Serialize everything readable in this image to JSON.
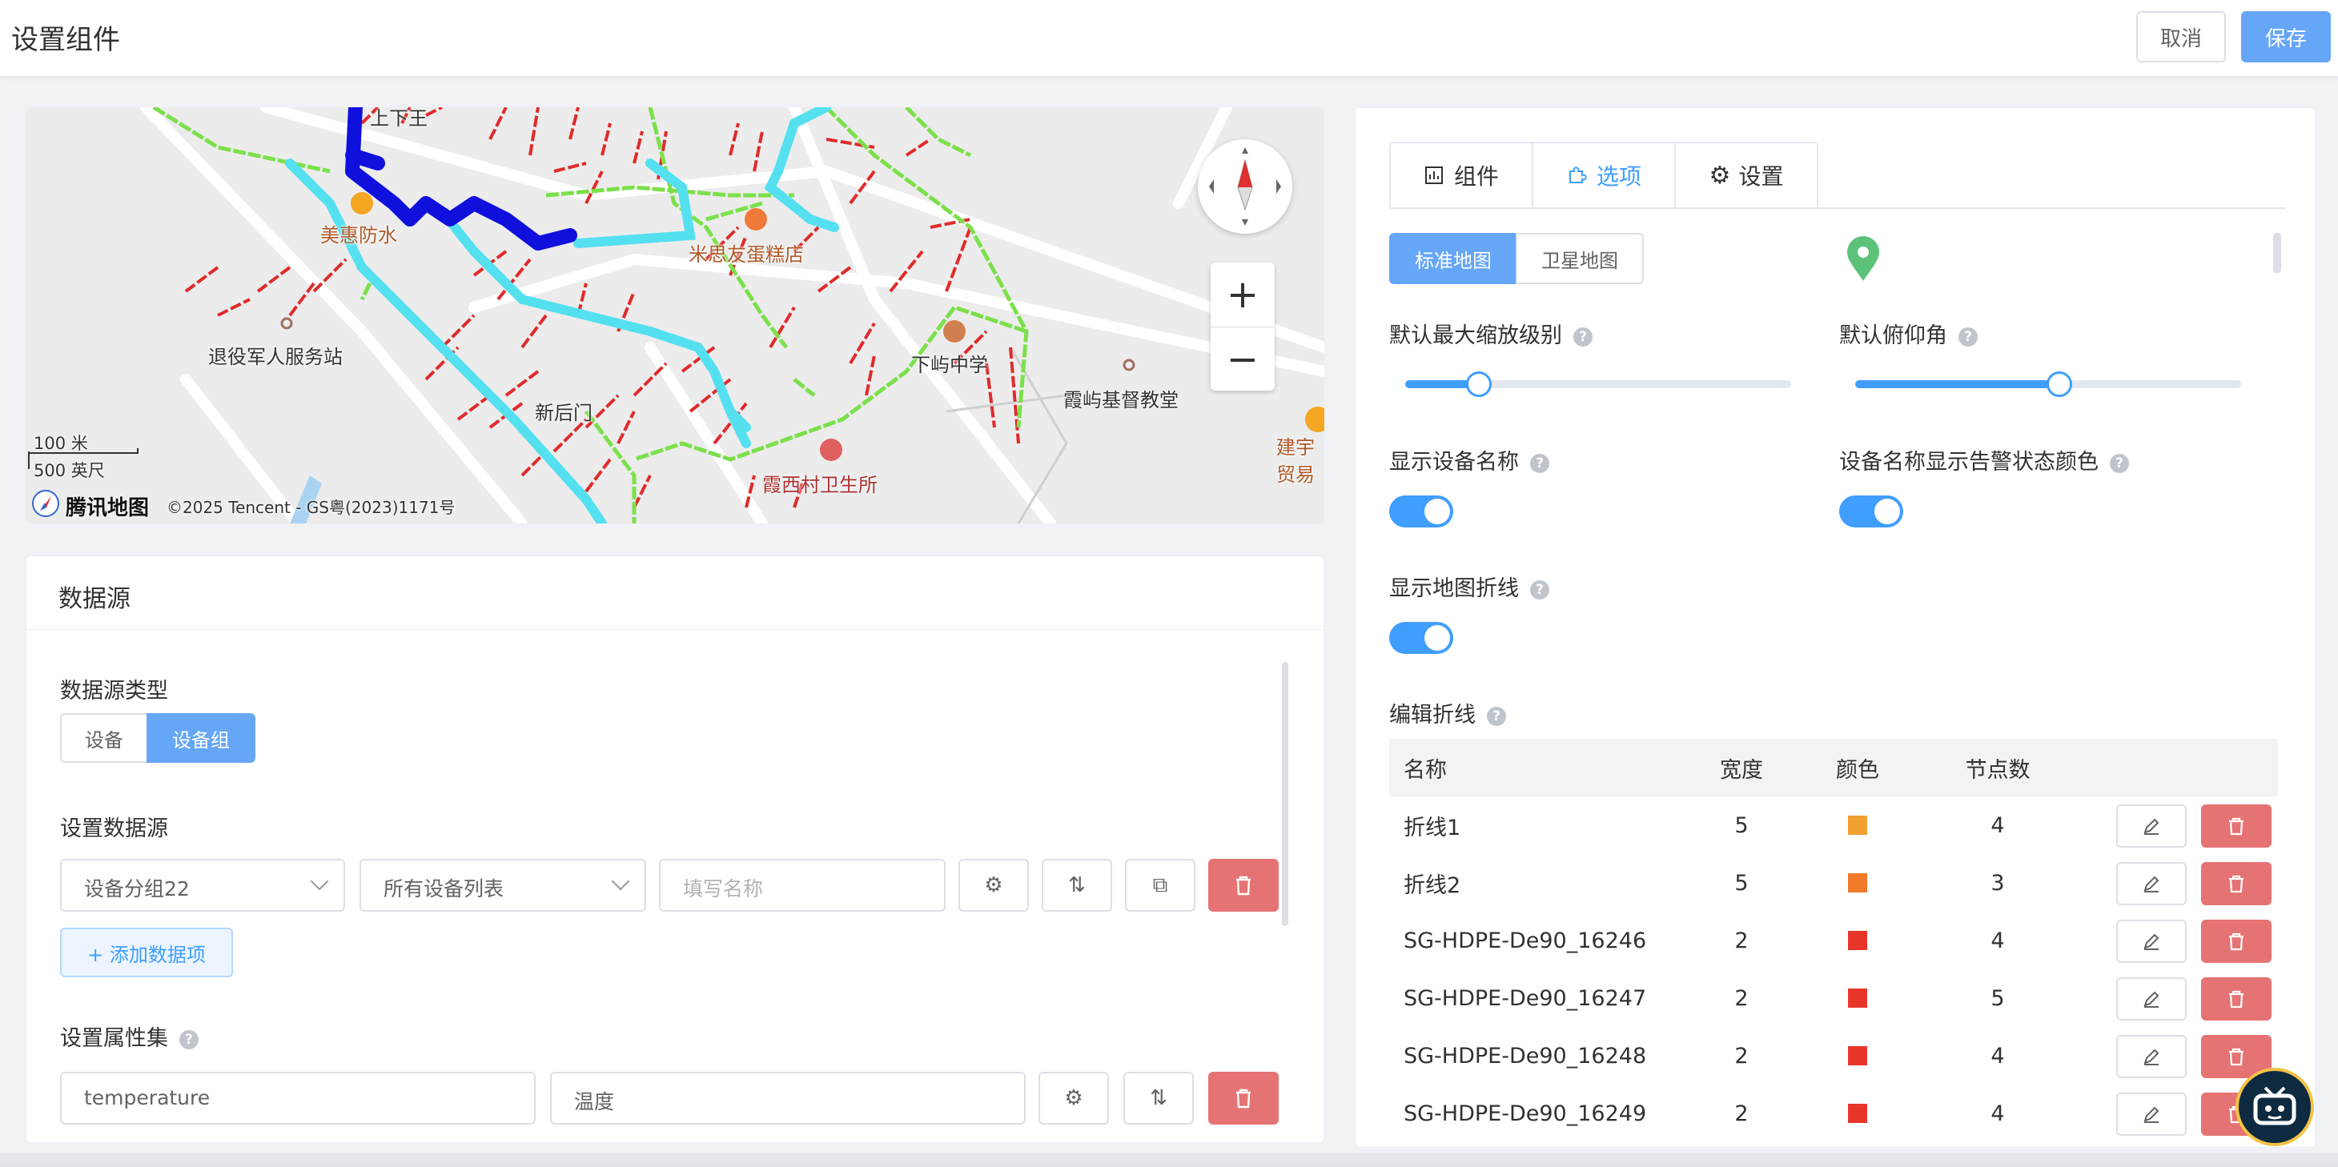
{
  "header": {
    "title": "设置组件",
    "cancel_label": "取消",
    "save_label": "保存"
  },
  "map": {
    "labels": {
      "village_top": "上下王",
      "shop1": "美惠防水",
      "shop2": "米思友蛋糕店",
      "station": "退役军人服务站",
      "school": "下屿中学",
      "church": "霞屿基督教堂",
      "gate": "新后门",
      "clinic": "霞西村卫生所",
      "trade": "建宇贸易"
    },
    "scale_m": "100 米",
    "scale_ft": "500 英尺",
    "brand": "腾讯地图",
    "copyright": "©2025 Tencent - GS粤(2023)1171号",
    "zoom_in": "+",
    "zoom_out": "−"
  },
  "datasource": {
    "title": "数据源",
    "type_label": "数据源类型",
    "type_options": [
      "设备",
      "设备组"
    ],
    "type_selected": "设备组",
    "source_label": "设置数据源",
    "group_select": "设备分组22",
    "list_select": "所有设备列表",
    "name_placeholder": "填写名称",
    "add_label": "+ 添加数据项",
    "attr_label": "设置属性集",
    "attr_key": "temperature",
    "attr_name": "温度"
  },
  "options": {
    "tabs": [
      {
        "label": "组件",
        "icon": "chart-icon"
      },
      {
        "label": "选项",
        "icon": "puzzle-icon"
      },
      {
        "label": "设置",
        "icon": "gear-icon"
      }
    ],
    "active_tab": "选项",
    "map_types": [
      "标准地图",
      "卫星地图"
    ],
    "map_type_selected": "标准地图",
    "max_zoom_label": "默认最大缩放级别",
    "max_zoom_fraction": 0.19,
    "pitch_label": "默认俯仰角",
    "pitch_fraction": 0.53,
    "show_name_label": "显示设备名称",
    "show_name_on": true,
    "alarm_color_label": "设备名称显示告警状态颜色",
    "alarm_color_on": true,
    "show_polyline_label": "显示地图折线",
    "show_polyline_on": true,
    "edit_polyline_label": "编辑折线",
    "help": "?",
    "table": {
      "headers": [
        "名称",
        "宽度",
        "颜色",
        "节点数"
      ],
      "rows": [
        {
          "name": "折线1",
          "width": "5",
          "color": "#f0a030",
          "nodes": "4"
        },
        {
          "name": "折线2",
          "width": "5",
          "color": "#f07a2a",
          "nodes": "3"
        },
        {
          "name": "SG-HDPE-De90_16246",
          "width": "2",
          "color": "#e8352a",
          "nodes": "4"
        },
        {
          "name": "SG-HDPE-De90_16247",
          "width": "2",
          "color": "#e8352a",
          "nodes": "5"
        },
        {
          "name": "SG-HDPE-De90_16248",
          "width": "2",
          "color": "#e8352a",
          "nodes": "4"
        },
        {
          "name": "SG-HDPE-De90_16249",
          "width": "2",
          "color": "#e8352a",
          "nodes": "4"
        }
      ]
    }
  },
  "colors": {
    "primary": "#409eff",
    "danger": "#e57373",
    "marker": "#5cc27a"
  }
}
